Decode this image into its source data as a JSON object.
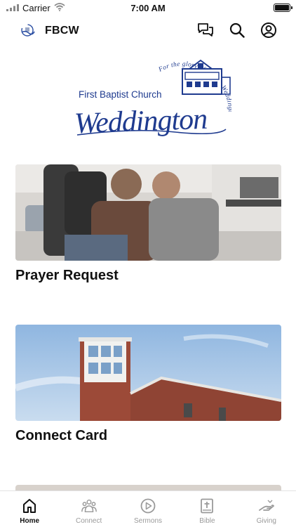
{
  "status_bar": {
    "carrier": "Carrier",
    "time": "7:00 AM",
    "battery_level": 1.0
  },
  "header": {
    "title": "FBCW",
    "icons": {
      "logo": "church-logo-icon",
      "messages": "chat-icon",
      "search": "search-icon",
      "account": "account-icon"
    }
  },
  "church_logo": {
    "name_line": "First Baptist Church",
    "script_line": "Weddington",
    "arc_text": "For the glory of God in Weddington and the world",
    "brand_color": "#1f3b8f"
  },
  "cards": [
    {
      "title": "Prayer Request",
      "image": "people-praying-photo"
    },
    {
      "title": "Connect Card",
      "image": "church-building-photo"
    }
  ],
  "tabs": [
    {
      "label": "Home",
      "icon": "home-icon",
      "active": true
    },
    {
      "label": "Connect",
      "icon": "people-icon",
      "active": false
    },
    {
      "label": "Sermons",
      "icon": "play-circle-icon",
      "active": false
    },
    {
      "label": "Bible",
      "icon": "bible-icon",
      "active": false
    },
    {
      "label": "Giving",
      "icon": "giving-hand-icon",
      "active": false
    }
  ]
}
